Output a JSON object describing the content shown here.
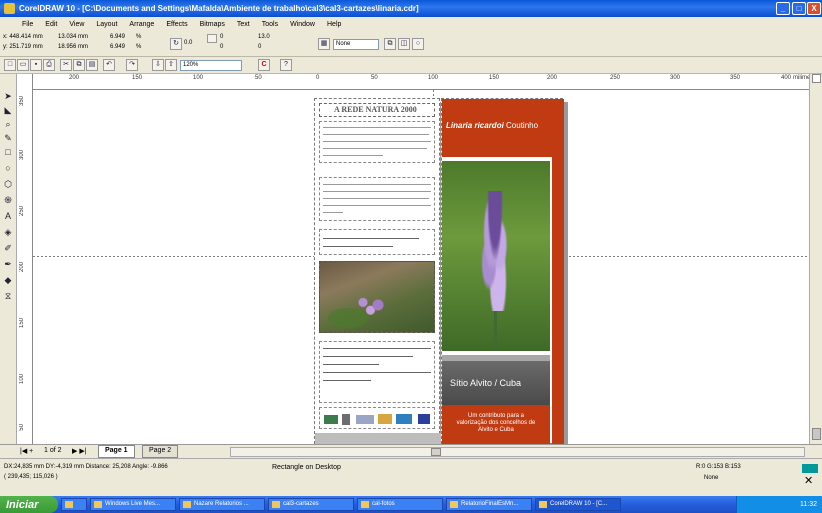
{
  "window": {
    "title": "CorelDRAW 10 - [C:\\Documents and Settings\\Mafalda\\Ambiente de trabalho\\cal3\\cal3-cartazes\\linaria.cdr]",
    "controls": {
      "minimize": "_",
      "maximize": "□",
      "close": "X"
    }
  },
  "menu": [
    "File",
    "Edit",
    "View",
    "Layout",
    "Arrange",
    "Effects",
    "Bitmaps",
    "Text",
    "Tools",
    "Window",
    "Help"
  ],
  "property_bar": {
    "x": "x: 448.414 mm",
    "y": "y: 251.719 mm",
    "width": "13.034 mm",
    "height": "18.956 mm",
    "scale_w": "6.949",
    "scale_h": "6.949",
    "pct": "%",
    "angle": "0.0",
    "pos_x": "0",
    "pos_y": "0",
    "size_a": "13.0",
    "size_b": "0",
    "outline": "None"
  },
  "standard_bar": {
    "zoom": "120%"
  },
  "ruler": {
    "h_labels": [
      "200",
      "150",
      "100",
      "50",
      "0",
      "50",
      "100",
      "150",
      "200",
      "250",
      "300",
      "350",
      "400"
    ],
    "unit": "milimetros",
    "v_labels": [
      "350",
      "300",
      "250",
      "200",
      "150",
      "100",
      "50"
    ]
  },
  "document": {
    "left_heading": "A REDE NATURA 2000",
    "right_title_bold": "Linaria ricardoi",
    "right_title_rest": "Coutinho",
    "site_label": "Sítio Alvito / Cuba",
    "footer_text": "Um contributo para a valorização dos concelhos de Alvito e Cuba"
  },
  "page_tabs": {
    "nav": "1 of 2",
    "tabs": [
      "Page 1",
      "Page 2"
    ]
  },
  "status": {
    "line1": "DX:24,835 mm DY:-4,319 mm Distance: 25,208 Angle: -9.866",
    "line2": "( 239,435; 115,026 )",
    "object": "Rectangle on Desktop",
    "fill": "R:0 G:153 B:153",
    "outline": "None"
  },
  "taskbar": {
    "start": "Iniciar",
    "items": [
      "Windows Live Mes...",
      "Nazare Relatorios ...",
      "cal3-cartazes",
      "cal-fotos",
      "RelatorioFinalEsMn...",
      "CorelDRAW 10 - [C..."
    ],
    "clock": "11:32"
  },
  "colors": {
    "accent_red": "#c03b12",
    "title_blue": "#0a58d8",
    "status_swatch": "#009999"
  }
}
